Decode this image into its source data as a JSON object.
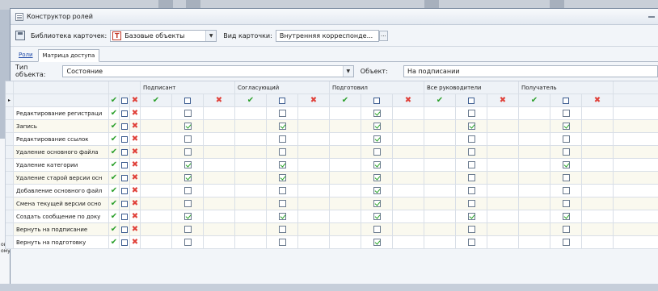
{
  "window": {
    "title": "Конструктор ролей"
  },
  "toolbar": {
    "library_label": "Библиотека карточек:",
    "library_value": "Базовые объекты",
    "view_label": "Вид карточки:",
    "view_value": "Внутренняя корреспонде...",
    "more_button": "..."
  },
  "tabs": [
    {
      "label": "Роли"
    },
    {
      "label": "Матрица доступа"
    }
  ],
  "filter": {
    "type_label": "Тип объекта:",
    "type_value": "Состояние",
    "object_label": "Объект:",
    "object_value": "На подписании"
  },
  "left_pane": {
    "labels": [
      "ово",
      "ому"
    ]
  },
  "grid": {
    "groups": [
      {
        "label": "Подписант"
      },
      {
        "label": "Согласующий"
      },
      {
        "label": "Подготовил"
      },
      {
        "label": "Все руководители"
      },
      {
        "label": "Получатель"
      }
    ],
    "rows": [
      {
        "name": "Редактирование регистраци",
        "values": [
          false,
          false,
          true,
          false,
          false
        ]
      },
      {
        "name": "Запись",
        "values": [
          true,
          true,
          true,
          true,
          true
        ]
      },
      {
        "name": "Редактирование ссылок",
        "values": [
          false,
          false,
          true,
          false,
          false
        ]
      },
      {
        "name": "Удаление основного файла",
        "values": [
          false,
          false,
          false,
          false,
          false
        ]
      },
      {
        "name": "Удаление категории",
        "values": [
          true,
          true,
          true,
          false,
          true
        ]
      },
      {
        "name": "Удаление старой версии осн",
        "values": [
          true,
          true,
          true,
          false,
          false
        ]
      },
      {
        "name": "Добавление основного файл",
        "values": [
          false,
          false,
          true,
          false,
          false
        ]
      },
      {
        "name": "Смена текущей версии осно",
        "values": [
          false,
          false,
          true,
          false,
          false
        ]
      },
      {
        "name": "Создать сообщение по доку",
        "values": [
          true,
          true,
          true,
          true,
          true
        ]
      },
      {
        "name": "Вернуть на подписание",
        "values": [
          false,
          false,
          false,
          false,
          false
        ]
      },
      {
        "name": "Вернуть на подготовку",
        "values": [
          false,
          false,
          true,
          false,
          false
        ]
      }
    ]
  }
}
